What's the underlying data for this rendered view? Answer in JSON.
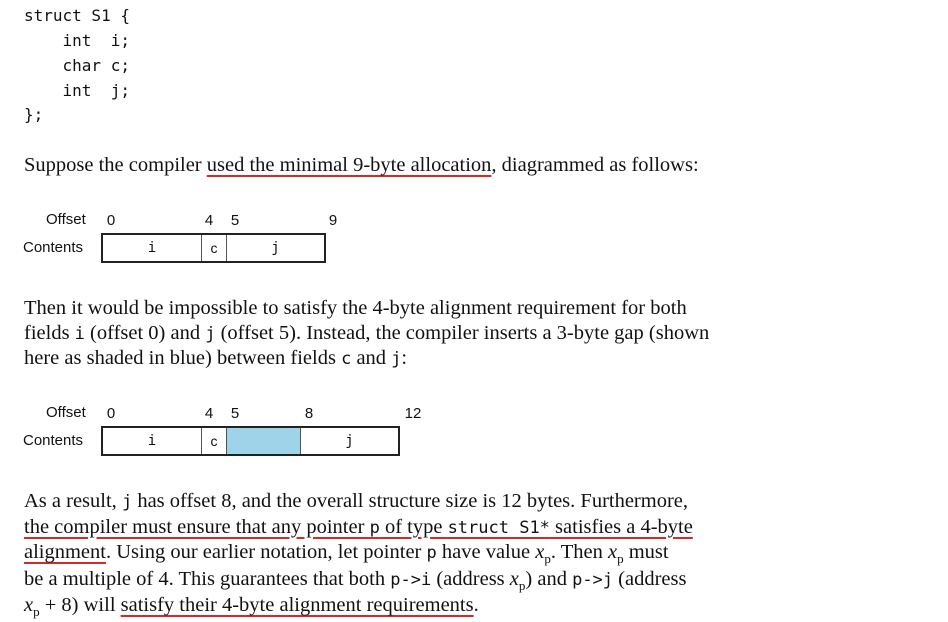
{
  "code": [
    "struct S1 {",
    "    int  i;",
    "    char c;",
    "    int  j;",
    "};"
  ],
  "p1": {
    "a": "Suppose the compiler ",
    "u": "used the minimal 9-byte allocation",
    "b": ", diagrammed as follows:"
  },
  "diagram1": {
    "offset_label": "Offset",
    "contents_label": "Contents",
    "ticks": [
      "0",
      "4",
      "5",
      "9"
    ],
    "fields": [
      "i",
      "c",
      "j"
    ]
  },
  "p2": {
    "l1": "Then it would be impossible to satisfy the 4-byte alignment requirement for both",
    "l2a": "fields ",
    "l2i": "i",
    "l2b": " (offset 0) and ",
    "l2j": "j",
    "l2c": " (offset 5). Instead, the compiler inserts a 3-byte gap (shown",
    "l3a": "here as shaded in blue) between fields ",
    "l3c": "c",
    "l3b": " and ",
    "l3j": "j",
    "l3d": ":"
  },
  "diagram2": {
    "offset_label": "Offset",
    "contents_label": "Contents",
    "ticks": [
      "0",
      "4",
      "5",
      "8",
      "12"
    ],
    "fields": [
      "i",
      "c",
      "j"
    ],
    "pad_color": "#9fd3ea"
  },
  "p3": {
    "l1a": "As a result, ",
    "l1j": "j",
    "l1b": " has offset 8, and the overall structure size is 12 bytes. Furthermore,",
    "l2a": "the compiler must ensure that any pointer ",
    "l2p": "p",
    "l2b": " of type ",
    "l2t": "struct S1*",
    "l2c": " satisfies a 4-byte",
    "l3a": "alignment",
    "l3b": ". Using our earlier notation, let pointer ",
    "l3p": "p",
    "l3c": " have value ",
    "xp_x": "x",
    "xp_sub": "p",
    "l3d": ". Then ",
    "l3e": " must",
    "l4a": "be a multiple of 4. This guarantees that both ",
    "l4pi": "p->i",
    "l4b": " (address ",
    "l4c": ") and ",
    "l4pj": "p->j",
    "l4d": " (address",
    "l5a": " + 8) will ",
    "l5u": "satisfy their 4-byte alignment requirements",
    "l5b": "."
  }
}
